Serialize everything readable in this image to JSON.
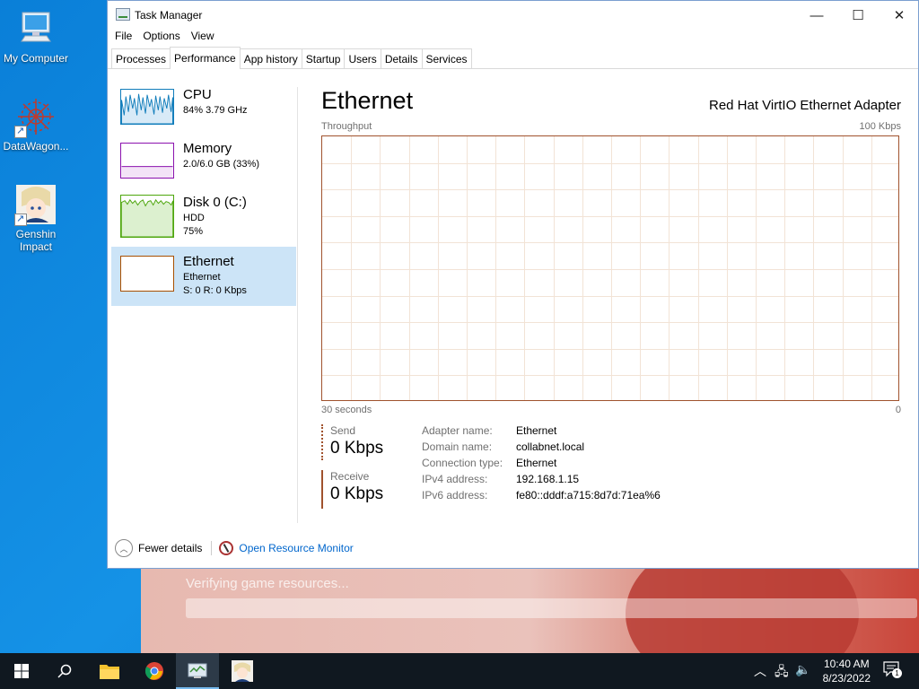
{
  "desktop": {
    "icons": [
      {
        "label": "My Computer",
        "icon": "computer-icon"
      },
      {
        "label": "DataWagon...",
        "icon": "datawagon-icon"
      },
      {
        "label": "Genshin Impact",
        "icon": "genshin-icon"
      }
    ]
  },
  "launcher": {
    "status_text": "Verifying game resources..."
  },
  "window": {
    "title": "Task Manager",
    "controls": {
      "minimize": "—",
      "maximize": "☐",
      "close": "✕"
    },
    "menu": [
      "File",
      "Options",
      "View"
    ],
    "tabs": [
      "Processes",
      "Performance",
      "App history",
      "Startup",
      "Users",
      "Details",
      "Services"
    ],
    "active_tab": "Performance"
  },
  "sidebar": {
    "items": [
      {
        "title": "CPU",
        "line1": "84%  3.79 GHz",
        "line2": "",
        "color": "#117dbb"
      },
      {
        "title": "Memory",
        "line1": "2.0/6.0 GB (33%)",
        "line2": "",
        "color": "#8b12ae"
      },
      {
        "title": "Disk 0 (C:)",
        "line1": "HDD",
        "line2": "75%",
        "color": "#4da60c"
      },
      {
        "title": "Ethernet",
        "line1": "Ethernet",
        "line2": "S: 0  R: 0 Kbps",
        "color": "#a74f01"
      }
    ],
    "selected": "Ethernet"
  },
  "detail": {
    "title": "Ethernet",
    "adapter": "Red Hat VirtIO Ethernet Adapter",
    "graph_label": "Throughput",
    "graph_max": "100 Kbps",
    "time_span": "30 seconds",
    "axis_min": "0",
    "send_label": "Send",
    "send_value": "0 Kbps",
    "receive_label": "Receive",
    "receive_value": "0 Kbps",
    "properties": [
      {
        "key": "Adapter name:",
        "value": "Ethernet"
      },
      {
        "key": "Domain name:",
        "value": "collabnet.local"
      },
      {
        "key": "Connection type:",
        "value": "Ethernet"
      },
      {
        "key": "IPv4 address:",
        "value": "192.168.1.15"
      },
      {
        "key": "IPv6 address:",
        "value": "fe80::dddf:a715:8d7d:71ea%6"
      }
    ]
  },
  "footer": {
    "fewer_details": "Fewer details",
    "resource_monitor": "Open Resource Monitor"
  },
  "taskbar": {
    "time": "10:40 AM",
    "date": "8/23/2022",
    "notification_count": "1"
  },
  "colors": {
    "accent": "#0078d7",
    "selection": "#cce4f7",
    "ethernet_graph": "#a74f01"
  }
}
